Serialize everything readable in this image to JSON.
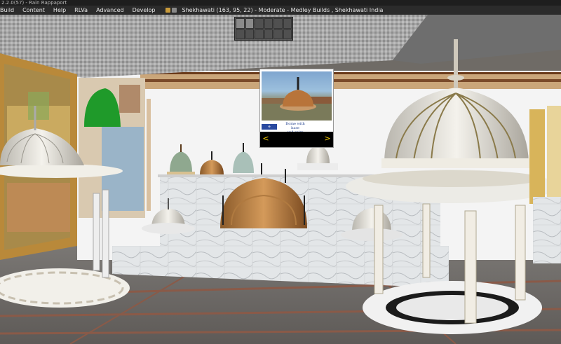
{
  "window": {
    "title": "2.2.0(57) - Rain Rappaport"
  },
  "menu": {
    "items": [
      "Build",
      "Content",
      "Help",
      "RLVa",
      "Advanced",
      "Develop"
    ],
    "location": "Shekhawati (163, 95, 22) - Moderate - Medley Builds , Shekhawati India"
  },
  "status_icons": [
    "voice-icon",
    "build-icon"
  ],
  "sign": {
    "caption_line1": "Dome with base",
    "caption_line2": "and spire",
    "prev_arrow": "<",
    "next_arrow": ">"
  },
  "colors": {
    "menubar": "#2b2b2b",
    "title": "#1e1e1e",
    "sign_nav": "#000000",
    "sign_arrows": "#ffd400",
    "sign_text": "#1a3a8a"
  }
}
